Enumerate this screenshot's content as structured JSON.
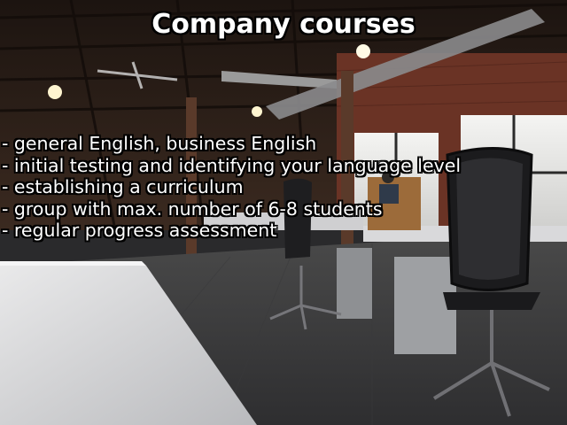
{
  "slide": {
    "title": "Company courses",
    "bullets": [
      "- general English, business English",
      "- initial testing and identifying your language level",
      "- establishing a curriculum",
      "- group with max. number of 6-8 students",
      "- regular progress assessment"
    ]
  }
}
